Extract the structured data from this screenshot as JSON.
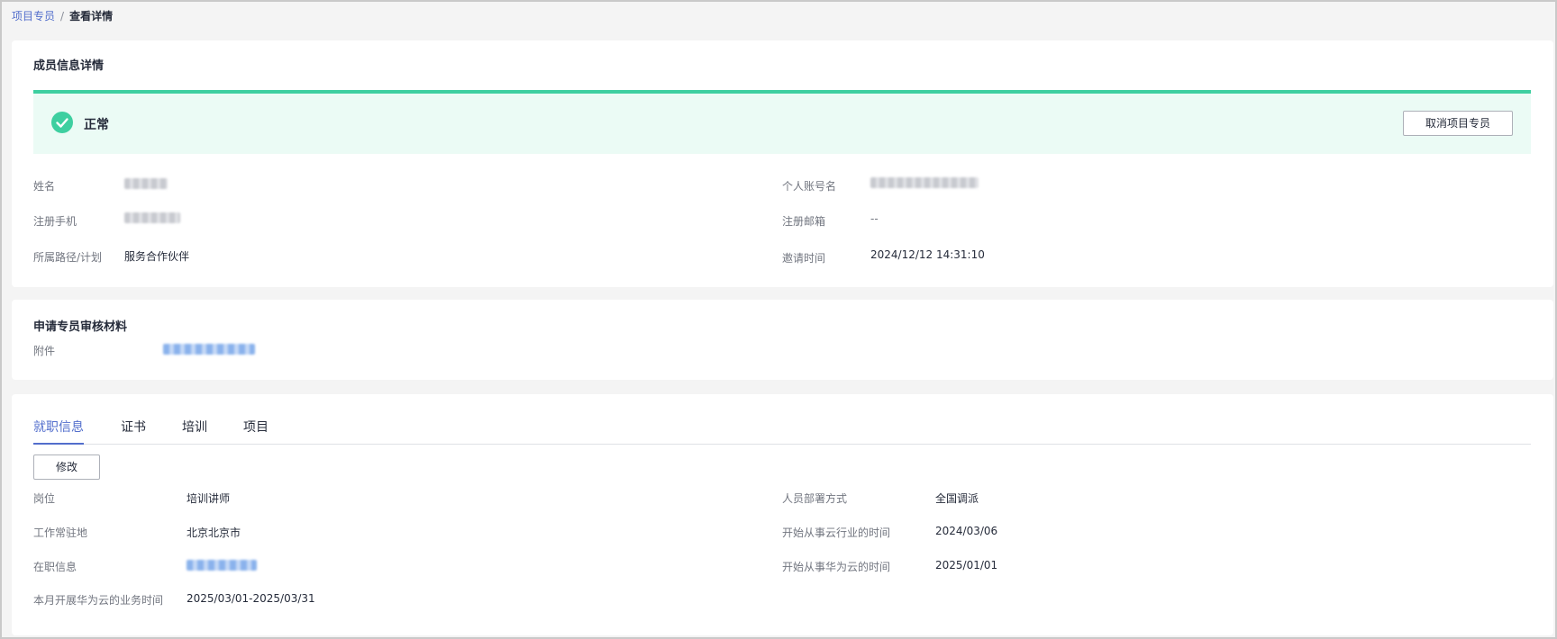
{
  "breadcrumb": {
    "parent": "项目专员",
    "separator": "/",
    "current": "查看详情"
  },
  "member_card": {
    "title": "成员信息详情",
    "status": {
      "text": "正常",
      "icon": "check-circle-icon",
      "color": "#3ecfa0"
    },
    "cancel_button": "取消项目专员",
    "fields": {
      "name_label": "姓名",
      "phone_label": "注册手机",
      "path_label": "所属路径/计划",
      "path_value": "服务合作伙伴",
      "account_label": "个人账号名",
      "email_label": "注册邮箱",
      "email_value": "--",
      "invite_time_label": "邀请时间",
      "invite_time_value": "2024/12/12 14:31:10"
    }
  },
  "materials_card": {
    "title": "申请专员审核材料",
    "attachment_label": "附件"
  },
  "tabs_card": {
    "tabs": [
      "就职信息",
      "证书",
      "培训",
      "项目"
    ],
    "active_tab": "就职信息",
    "edit_button": "修改",
    "fields": {
      "position_label": "岗位",
      "position_value": "培训讲师",
      "location_label": "工作常驻地",
      "location_value": "北京北京市",
      "employment_label": "在职信息",
      "business_time_label": "本月开展华为云的业务时间",
      "business_time_value": "2025/03/01-2025/03/31",
      "deployment_label": "人员部署方式",
      "deployment_value": "全国调派",
      "cloud_start_label": "开始从事云行业的时间",
      "cloud_start_value": "2024/03/06",
      "huawei_start_label": "开始从事华为云的时间",
      "huawei_start_value": "2025/01/01"
    }
  },
  "colors": {
    "accent": "#526ecc",
    "success": "#3ecfa0",
    "success_bg": "#ebfbf5"
  }
}
